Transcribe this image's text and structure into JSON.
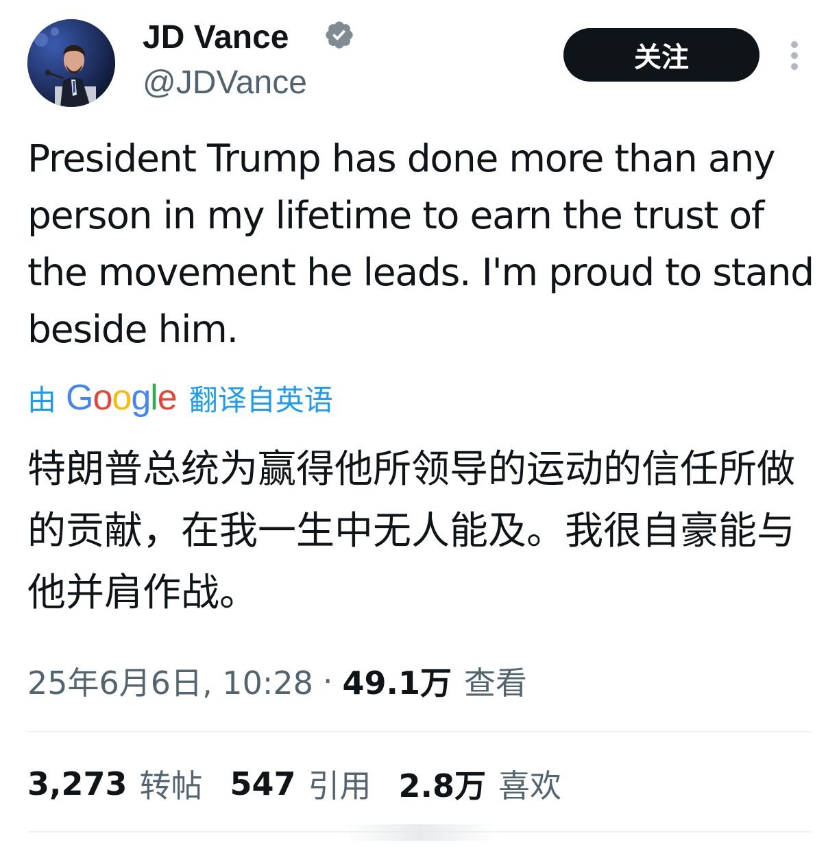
{
  "author": {
    "display_name": "JD Vance",
    "handle": "@JDVance",
    "verified": true
  },
  "follow_button": {
    "label": "关注"
  },
  "tweet": {
    "text": "President Trump has done more than any person in my lifetime to earn the trust of the movement he leads. I'm proud to stand beside him.",
    "translation": {
      "prefix": "由",
      "provider": "Google",
      "suffix": "翻译自英语",
      "text": "特朗普总统为赢得他所领导的运动的信任所做的贡献，在我一生中无人能及。我很自豪能与他并肩作战。"
    },
    "meta": {
      "timestamp": "25年6月6日, 10:28",
      "separator": "·",
      "views_count": "49.1万",
      "views_label": "查看"
    }
  },
  "stats": [
    {
      "count": "3,273",
      "label": "转帖"
    },
    {
      "count": "547",
      "label": "引用"
    },
    {
      "count": "2.8万",
      "label": "喜欢"
    }
  ],
  "colors": {
    "text_primary": "#0f1419",
    "text_secondary": "#536471",
    "link_blue": "#1d9bf0",
    "verified_blue": "#808b94",
    "divider": "#eff3f4"
  },
  "icons": {
    "verified": "verified-badge-icon",
    "more": "more-vertical-icon"
  }
}
